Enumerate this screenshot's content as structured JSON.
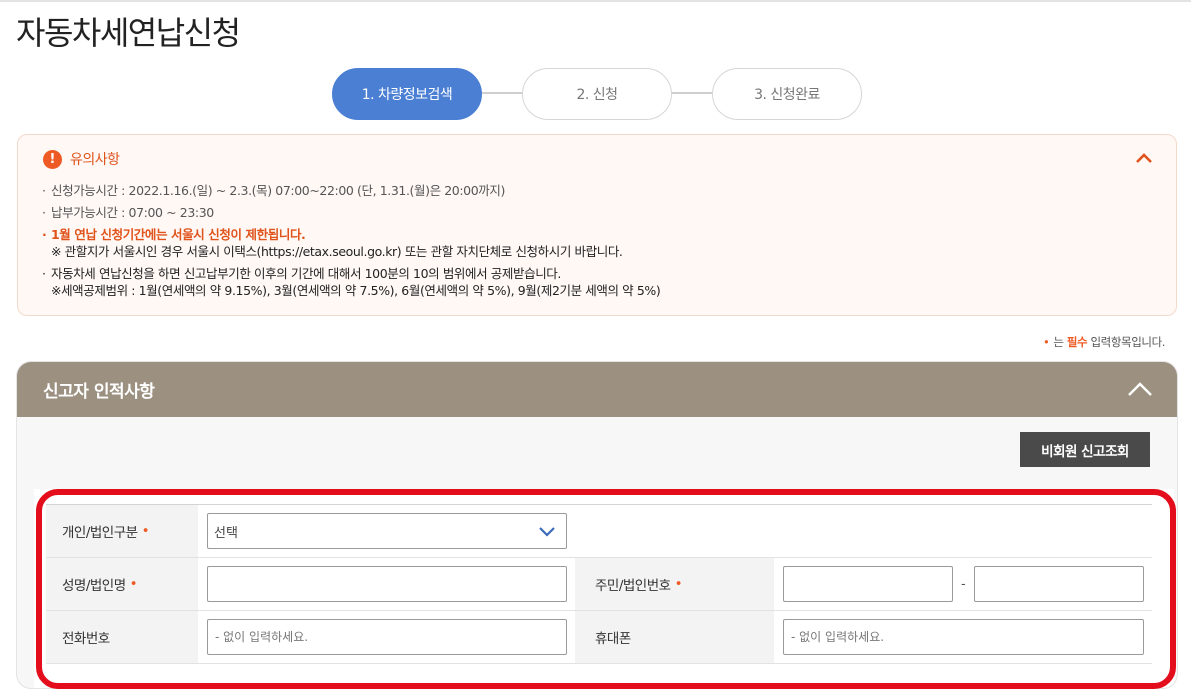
{
  "page": {
    "title": "자동차세연납신청"
  },
  "steps": [
    {
      "label": "1. 차량정보검색",
      "active": true
    },
    {
      "label": "2. 신청",
      "active": false
    },
    {
      "label": "3. 신청완료",
      "active": false
    }
  ],
  "notice": {
    "title": "유의사항",
    "icon": "!",
    "line1": "신청가능시간 : 2022.1.16.(일) ~ 2.3.(목) 07:00~22:00 (단, 1.31.(월)은 20:00까지)",
    "line2": "납부가능시간 : 07:00 ~ 23:30",
    "line3": "1월 연납 신청기간에는 서울시 신청이 제한됩니다.",
    "line3_sub": "※ 관할지가 서울시인 경우 서울시 이택스(https://etax.seoul.go.kr) 또는 관할 자치단체로 신청하시기 바랍니다.",
    "line4": "자동차세 연납신청을 하면 신고납부기한 이후의 기간에 대해서 100분의 10의 범위에서 공제받습니다.",
    "line4_sub": "※세액공제범위 : 1월(연세액의 약 9.15%), 3월(연세액의 약 7.5%), 6월(연세액의 약 5%), 9월(제2기분 세액의 약 5%)"
  },
  "required_note": {
    "dot": "•",
    "pre": "는",
    "must": "필수",
    "post": "입력항목입니다."
  },
  "panel": {
    "title": "신고자 인적사항",
    "lookup_button": "비회원 신고조회"
  },
  "form": {
    "type_label": "개인/법인구분",
    "type_value": "선택",
    "name_label": "성명/법인명",
    "id_label": "주민/법인번호",
    "id_dash": "-",
    "phone_label": "전화번호",
    "phone_placeholder": "- 없이 입력하세요.",
    "mobile_label": "휴대폰",
    "mobile_placeholder": "- 없이 입력하세요.",
    "required_mark": "•"
  },
  "colors": {
    "accent": "#4a7fd4",
    "warning": "#ee5a24",
    "panel_header": "#9c9080",
    "highlight": "#e30d1c"
  }
}
